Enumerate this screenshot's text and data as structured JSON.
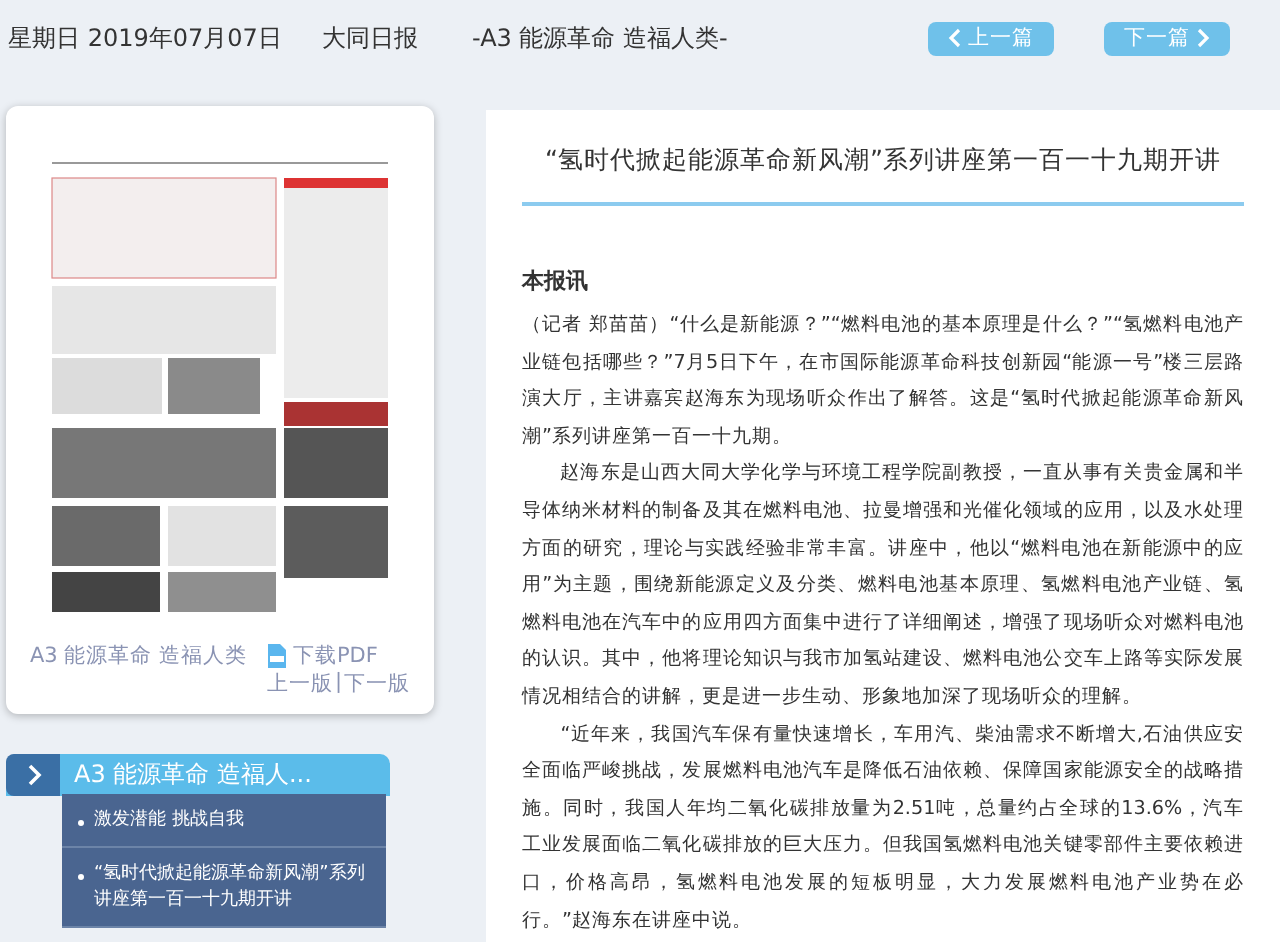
{
  "header": {
    "date": "星期日 2019年07月07日",
    "paper": "大同日报",
    "page_title": "-A3 能源革命 造福人类-",
    "prev_button": "上一篇",
    "next_button": "下一篇"
  },
  "page_card": {
    "page_link": "A3 能源革命 造福人类",
    "download": "下载PDF",
    "prev_page": "上一版",
    "separator": "|",
    "next_page": "下一版"
  },
  "article_nav": {
    "title": "A3  能源革命 造福人...",
    "items": [
      {
        "text": "激发潜能 挑战自我"
      },
      {
        "text": "“氢时代掀起能源革命新风潮”系列讲座第一百一十九期开讲"
      }
    ]
  },
  "article": {
    "title": "“氢时代掀起能源革命新风潮”系列讲座第一百一十九期开讲",
    "byline": "本报讯",
    "paragraphs": [
      "（记者 郑苗苗）“什么是新能源？”“燃料电池的基本原理是什么？”“氢燃料电池产业链包括哪些？”7月5日下午，在市国际能源革命科技创新园“能源一号”楼三层路演大厅，主讲嘉宾赵海东为现场听众作出了解答。这是“氢时代掀起能源革命新风潮”系列讲座第一百一十九期。",
      "赵海东是山西大同大学化学与环境工程学院副教授，一直从事有关贵金属和半导体纳米材料的制备及其在燃料电池、拉曼增强和光催化领域的应用，以及水处理方面的研究，理论与实践经验非常丰富。讲座中，他以“燃料电池在新能源中的应用”为主题，围绕新能源定义及分类、燃料电池基本原理、氢燃料电池产业链、氢燃料电池在汽车中的应用四方面集中进行了详细阐述，增强了现场听众对燃料电池的认识。其中，他将理论知识与我市加氢站建设、燃料电池公交车上路等实际发展情况相结合的讲解，更是进一步生动、形象地加深了现场听众的理解。",
      "“近年来，我国汽车保有量快速增长，车用汽、柴油需求不断增大,石油供应安全面临严峻挑战，发展燃料电池汽车是降低石油依赖、保障国家能源安全的战略措施。同时，我国人年均二氧化碳排放量为2.51吨，总量约占全球的13.6%，汽车工业发展面临二氧化碳排放的巨大压力。但我国氢燃料电池关键零部件主要依赖进口，价格高昂，氢燃料电池发展的短板明显，大力发展燃料电池产业势在必行。”赵海东在讲座中说。"
    ]
  }
}
